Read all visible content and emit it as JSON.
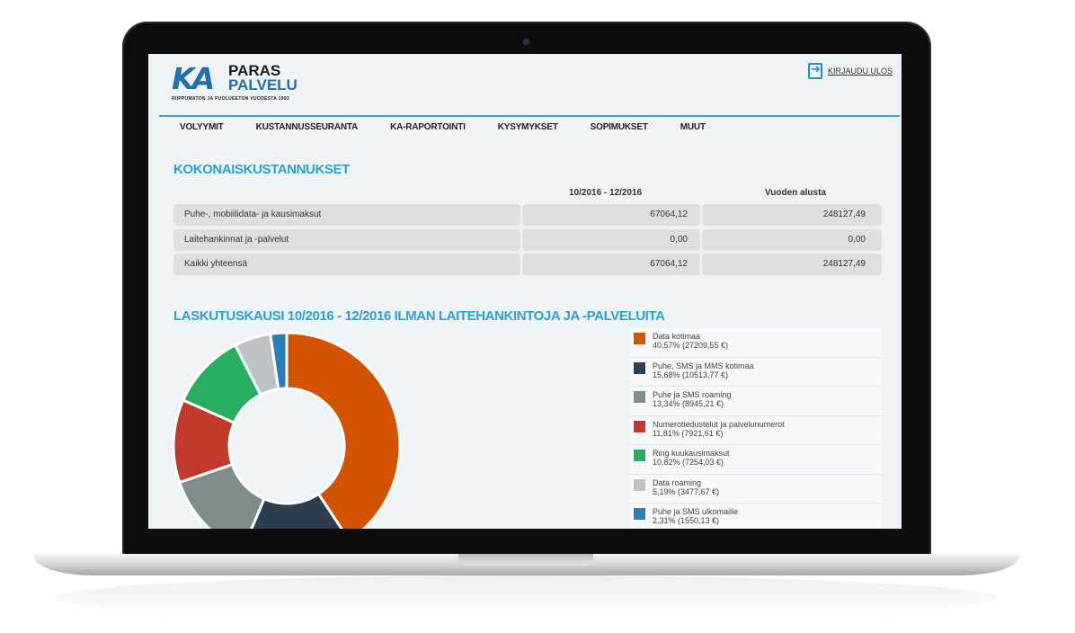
{
  "header": {
    "logo": {
      "mark": "KA",
      "line1": "PARAS",
      "line2": "PALVELU",
      "tagline": "RIIPPUMATON JA PUOLUEETON VUODESTA 1993"
    },
    "logout_label": "KIRJAUDU ULOS"
  },
  "nav": {
    "items": [
      {
        "label": "VOLYYMIT"
      },
      {
        "label": "KUSTANNUSSEURANTA"
      },
      {
        "label": "KA-RAPORTOINTI"
      },
      {
        "label": "KYSYMYKSET"
      },
      {
        "label": "SOPIMUKSET"
      },
      {
        "label": "MUUT"
      }
    ]
  },
  "costs": {
    "title": "KOKONAISKUSTANNUKSET",
    "col1": "10/2016 - 12/2016",
    "col2": "Vuoden alusta",
    "rows": [
      {
        "label": "Puhe-, mobiilidata- ja kausimaksut",
        "period": "67064,12",
        "ytd": "248127,49"
      },
      {
        "label": "Laitehankinnat ja -palvelut",
        "period": "0,00",
        "ytd": "0,00"
      },
      {
        "label": "Kaikki yhteensä",
        "period": "67064,12",
        "ytd": "248127,49"
      }
    ]
  },
  "billing": {
    "title": "LASKUTUSKAUSI 10/2016 - 12/2016 ILMAN LAITEHANKINTOJA JA -PALVELUITA"
  },
  "chart_data": {
    "type": "pie",
    "categories": [
      "Data kotimaa",
      "Puhe, SMS ja MMS kotimaa",
      "Puhe ja SMS roaming",
      "Numerotiedustelut ja palvelunumerot",
      "Ring kuukausimaksut",
      "Data roaming",
      "Puhe ja SMS ulkomaille"
    ],
    "values": [
      27209.55,
      10513.77,
      8945.21,
      7921.61,
      7254.03,
      3477.67,
      1550.13
    ],
    "percent_labels": [
      "40,57% (27209,55 €)",
      "15,68% (10513,77 €)",
      "13,34% (8945,21 €)",
      "11,81% (7921,61 €)",
      "10,82% (7254,03 €)",
      "5,19% (3477,67 €)",
      "2,31% (1550,13 €)"
    ],
    "colors": [
      "#d35400",
      "#2c3e50",
      "#7f8c8d",
      "#c0392b",
      "#27ae60",
      "#bdc3c7",
      "#2980b9"
    ],
    "donut": true
  }
}
